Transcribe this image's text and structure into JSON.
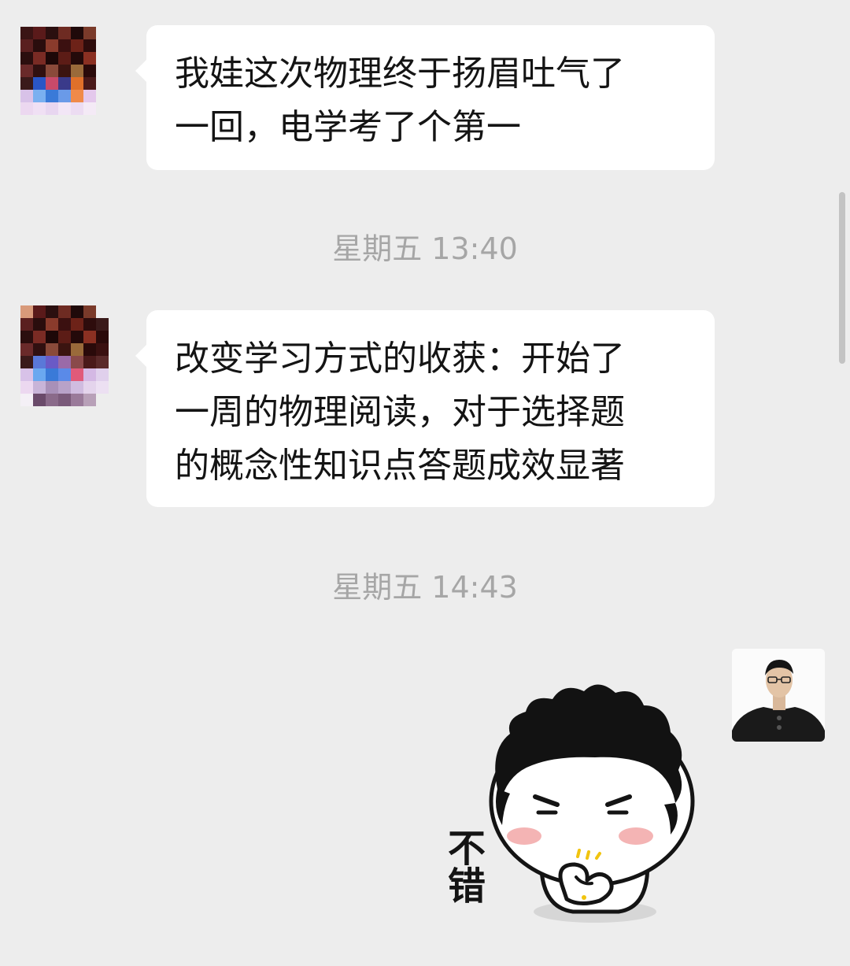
{
  "messages": [
    {
      "lines": [
        "我娃这次物理终于扬眉吐气了",
        "一回，电学考了个第一"
      ]
    },
    {
      "timestamp": "星期五 13:40",
      "lines": [
        "改变学习方式的收获：开始了",
        "一周的物理阅读，对于选择题",
        "的概念性知识点答题成效显著"
      ]
    },
    {
      "timestamp": "星期五 14:43"
    }
  ],
  "sticker": {
    "text": "不错"
  }
}
